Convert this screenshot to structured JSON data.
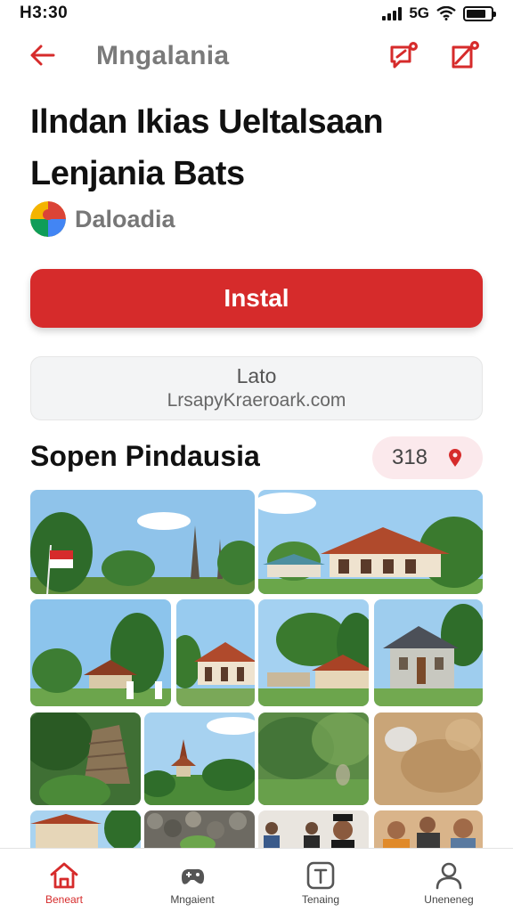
{
  "status_bar": {
    "time": "H3:30",
    "network": "5G"
  },
  "header": {
    "title": "Mngalania"
  },
  "app": {
    "title_line1": "Ilndan Ikias Ueltalsaan",
    "title_line2": "Lenjania Bats",
    "developer": "Daloadia",
    "install_label": "Instal",
    "info_line1": "Lato",
    "info_line2": "LrsapyKraeroark.com"
  },
  "section": {
    "title": "Sopen Pindausia",
    "rating_count": "318"
  },
  "gallery": {
    "rows": [
      [
        "tropical-monument",
        "red-roof-pavilion"
      ],
      [
        "village-hut",
        "school-building",
        "wooden-hall",
        "gray-house"
      ],
      [
        "stone-temple",
        "pagoda-garden",
        "blurred-greenery",
        "blurred-wood"
      ],
      [
        "house-trees",
        "stones-plant",
        "people-portraits",
        "family-group"
      ]
    ]
  },
  "nav": {
    "items": [
      {
        "label": "Beneart",
        "icon": "home-icon",
        "active": true
      },
      {
        "label": "Mngaient",
        "icon": "games-icon",
        "active": false
      },
      {
        "label": "Tenaing",
        "icon": "apps-icon",
        "active": false
      },
      {
        "label": "Uneneneg",
        "icon": "profile-icon",
        "active": false
      }
    ]
  },
  "colors": {
    "accent": "#d62b2b",
    "title_gray": "#7a7a7a",
    "pill_bg": "#fbe9ec"
  }
}
